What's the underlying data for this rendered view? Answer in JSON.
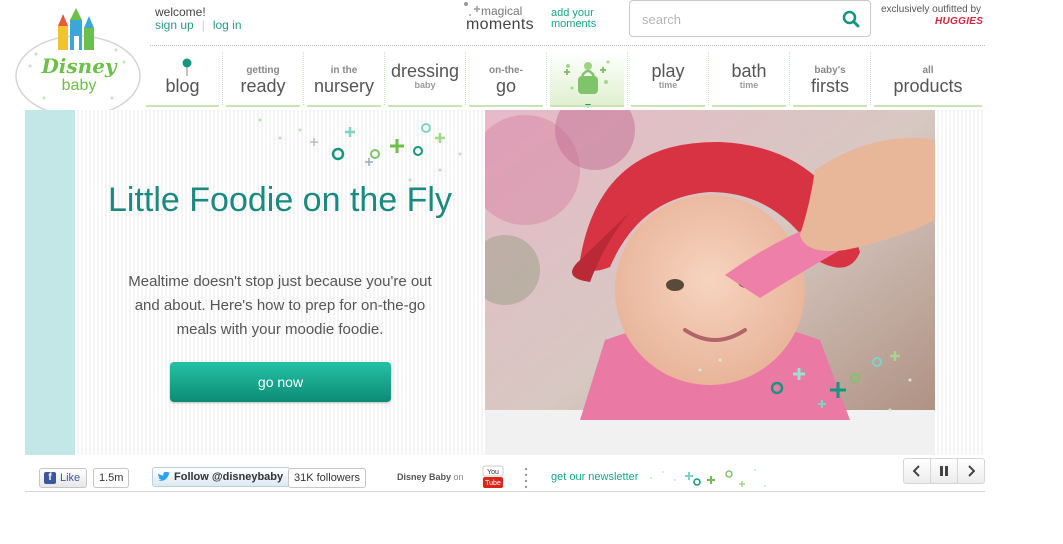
{
  "brand": {
    "logo_text_top": "Disney",
    "logo_text_bottom": "baby",
    "accent": "#1aa18b",
    "logo_green": "#6cc04a"
  },
  "account": {
    "welcome": "welcome!",
    "sign_up": "sign up",
    "log_in": "log in"
  },
  "moments": {
    "top": "magical",
    "bottom": "moments",
    "add_line1": "add your",
    "add_line2": "moments"
  },
  "search": {
    "placeholder": "search",
    "value": ""
  },
  "sponsor": {
    "line": "exclusively outfitted by",
    "brand": "HUGGIES"
  },
  "nav": {
    "blog": {
      "big": "blog"
    },
    "getting_ready": {
      "small": "getting",
      "big": "ready"
    },
    "nursery": {
      "small": "in the",
      "big": "nursery"
    },
    "dressing": {
      "big": "dressing",
      "tiny": "baby"
    },
    "on_the_go": {
      "small": "on-the-",
      "big": "go"
    },
    "play": {
      "big": "play",
      "tiny": "time"
    },
    "bath": {
      "big": "bath",
      "tiny": "time"
    },
    "firsts": {
      "small": "baby's",
      "big": "firsts"
    },
    "products": {
      "small": "all",
      "big": "products"
    }
  },
  "hero": {
    "title": "Little Foodie on the Fly",
    "description": "Mealtime doesn't stop just because you're out and about. Here's how to prep for on-the-go meals with your moodie foodie.",
    "button": "go now",
    "image_subject": "baby in red hat being fed with pink spoon"
  },
  "footer": {
    "like_label": "Like",
    "like_count": "1.5m",
    "follow_label": "Follow @disneybaby",
    "followers": "31K followers",
    "youtube_brand": "Disney Baby",
    "youtube_on": "on",
    "newsletter": "get our newsletter"
  },
  "icons": [
    "castle-icon",
    "search-icon",
    "nav-pin-icon",
    "diaper-bag-icon",
    "facebook-icon",
    "twitter-bird-icon",
    "youtube-icon",
    "prev-icon",
    "pause-icon",
    "next-icon"
  ]
}
